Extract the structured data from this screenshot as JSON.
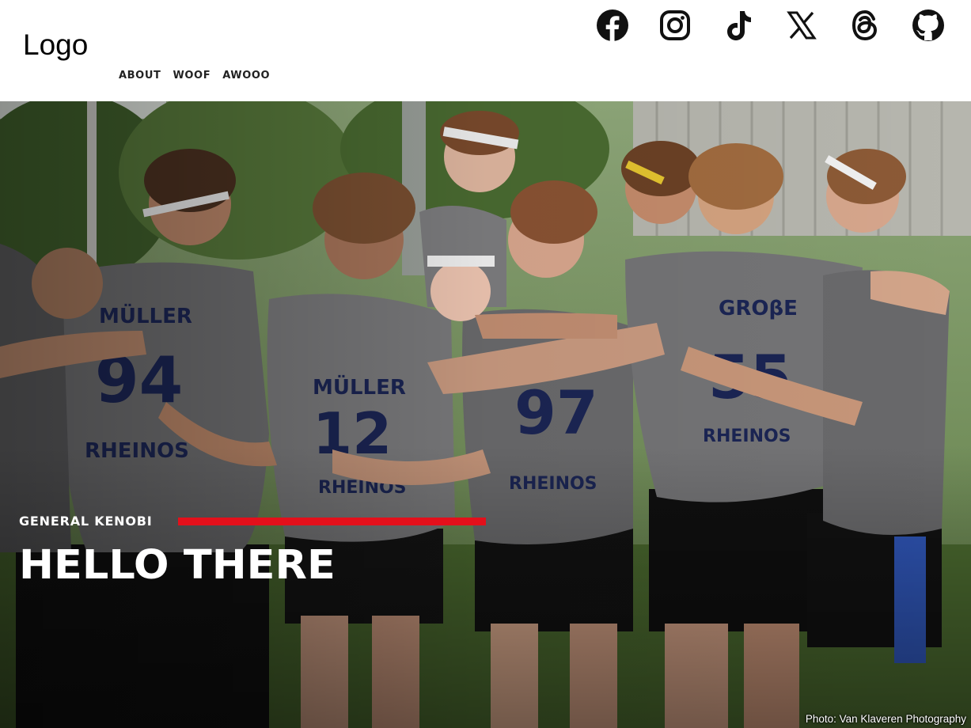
{
  "header": {
    "logo_text": "Logo",
    "nav": [
      {
        "label": "ABOUT"
      },
      {
        "label": "WOOF"
      },
      {
        "label": "AWOOO"
      }
    ],
    "social": [
      {
        "icon": "facebook-icon"
      },
      {
        "icon": "instagram-icon"
      },
      {
        "icon": "tiktok-icon"
      },
      {
        "icon": "x-icon"
      },
      {
        "icon": "threads-icon"
      },
      {
        "icon": "github-icon"
      }
    ]
  },
  "hero": {
    "kicker": "GENERAL KENOBI",
    "headline": "HELLO THERE",
    "photo_credit": "Photo: Van Klaveren Photography",
    "accent_color": "#e3101b"
  }
}
